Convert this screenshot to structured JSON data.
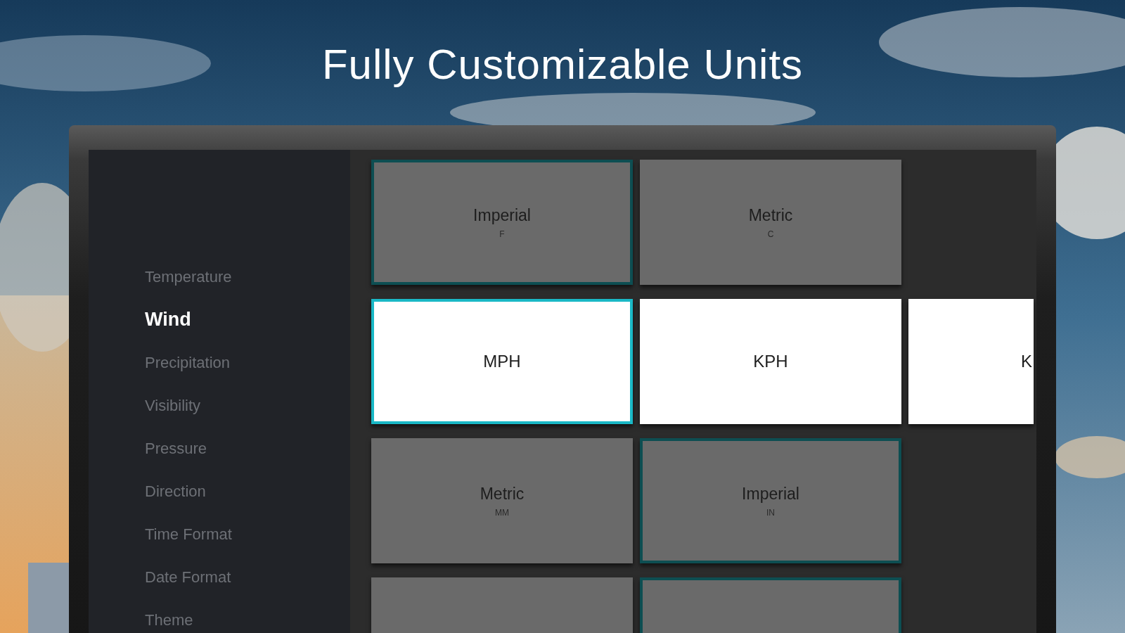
{
  "headline": "Fully Customizable Units",
  "sidebar": {
    "items": [
      {
        "label": "Temperature",
        "selected": false
      },
      {
        "label": "Wind",
        "selected": true
      },
      {
        "label": "Precipitation",
        "selected": false
      },
      {
        "label": "Visibility",
        "selected": false
      },
      {
        "label": "Pressure",
        "selected": false
      },
      {
        "label": "Direction",
        "selected": false
      },
      {
        "label": "Time Format",
        "selected": false
      },
      {
        "label": "Date Format",
        "selected": false
      },
      {
        "label": "Theme",
        "selected": false
      }
    ]
  },
  "option_rows": [
    {
      "focused": false,
      "options": [
        {
          "label": "Imperial",
          "unit": "F",
          "selected": true
        },
        {
          "label": "Metric",
          "unit": "C",
          "selected": false
        }
      ]
    },
    {
      "focused": true,
      "options": [
        {
          "label": "MPH",
          "selected": true
        },
        {
          "label": "KPH",
          "selected": false
        },
        {
          "label": "K",
          "selected": false
        }
      ]
    },
    {
      "focused": false,
      "options": [
        {
          "label": "Metric",
          "unit": "MM",
          "selected": false
        },
        {
          "label": "Imperial",
          "unit": "IN",
          "selected": true
        }
      ]
    },
    {
      "focused": false,
      "options": [
        {
          "selected": false
        },
        {
          "selected": true
        }
      ]
    }
  ]
}
